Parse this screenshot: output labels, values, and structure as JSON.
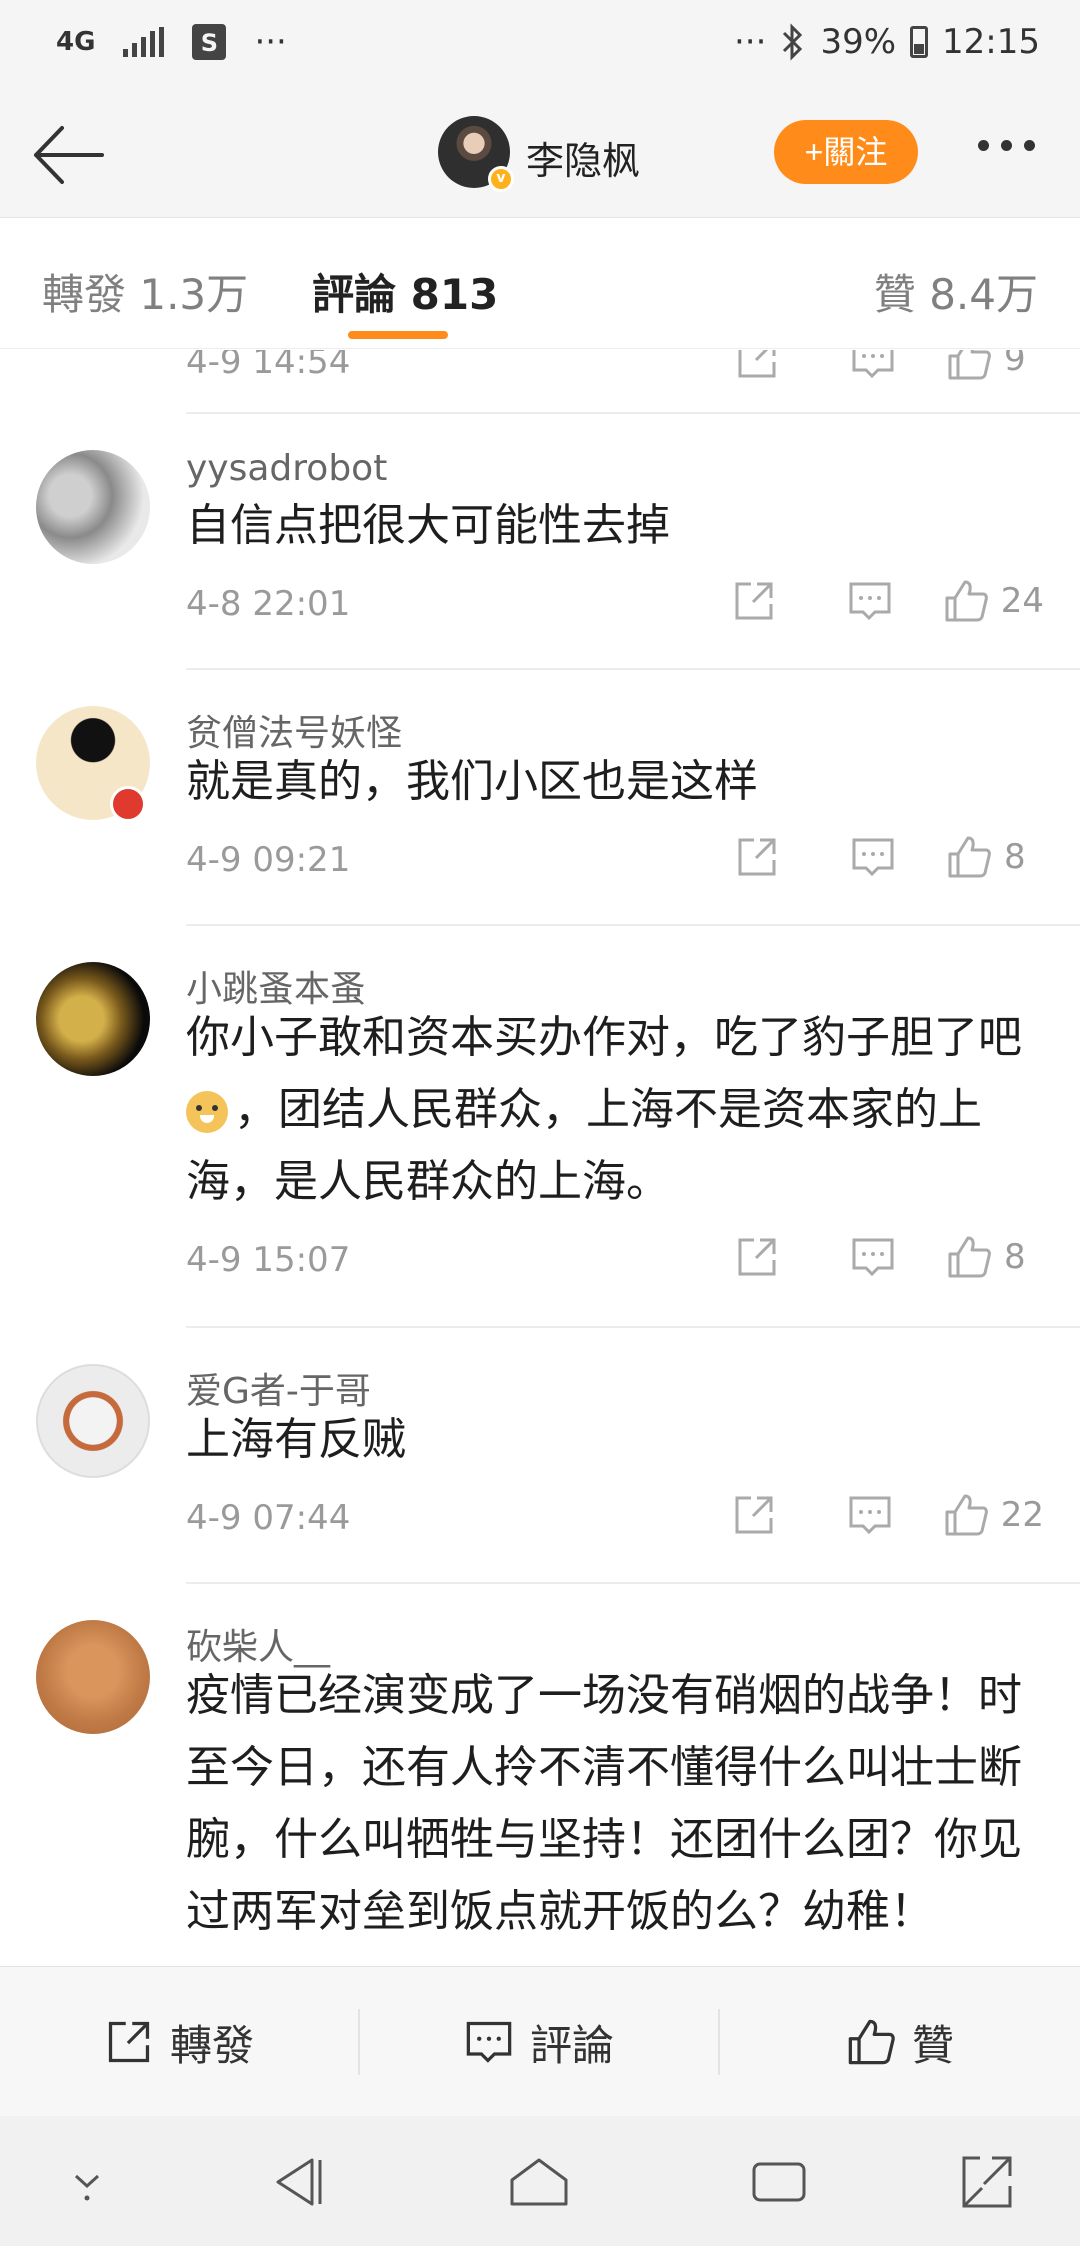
{
  "status_bar": {
    "network": "4G",
    "store_icon": "S",
    "more_left": "···",
    "more_right": "···",
    "battery": "39%",
    "time": "12:15"
  },
  "header": {
    "user_name": "李隐枫",
    "follow_label": "+關注"
  },
  "tabs": {
    "repost": "轉發 1.3万",
    "comments": "評論 813",
    "likes": "贊 8.4万"
  },
  "comments": [
    {
      "user": "",
      "text": "",
      "time": "4-9 14:54",
      "likes": "9"
    },
    {
      "user": "yysadrobot",
      "text": "自信点把很大可能性去掉",
      "time": "4-8 22:01",
      "likes": "24"
    },
    {
      "user": "贫僧法号妖怪",
      "text": "就是真的，我们小区也是这样",
      "time": "4-9 09:21",
      "likes": "8"
    },
    {
      "user": "小跳蚤本蚤",
      "text_line1": "你小子敢和资本买办作对，吃了豹子胆了吧",
      "text_line2": "，团结人民群众，上海不是资本家的上",
      "text_line3": "海，是人民群众的上海。",
      "time": "4-9 15:07",
      "likes": "8"
    },
    {
      "user": "爱G者-于哥",
      "text": "上海有反贼",
      "time": "4-9 07:44",
      "likes": "22"
    },
    {
      "user": "砍柴人__",
      "text_line1": "疫情已经演变成了一场没有硝烟的战争！时",
      "text_line2": "至今日，还有人拎不清不懂得什么叫壮士断",
      "text_line3": "腕，什么叫牺牲与坚持！还团什么团？你见",
      "text_line4": "过两军对垒到饭点就开饭的么？幼稚！"
    }
  ],
  "bottom_bar": {
    "repost": "轉發",
    "comment": "評論",
    "like": "贊"
  },
  "colors": {
    "accent": "#ff8c1a",
    "background": "#ffffff",
    "muted_text": "#9a9a9a"
  }
}
